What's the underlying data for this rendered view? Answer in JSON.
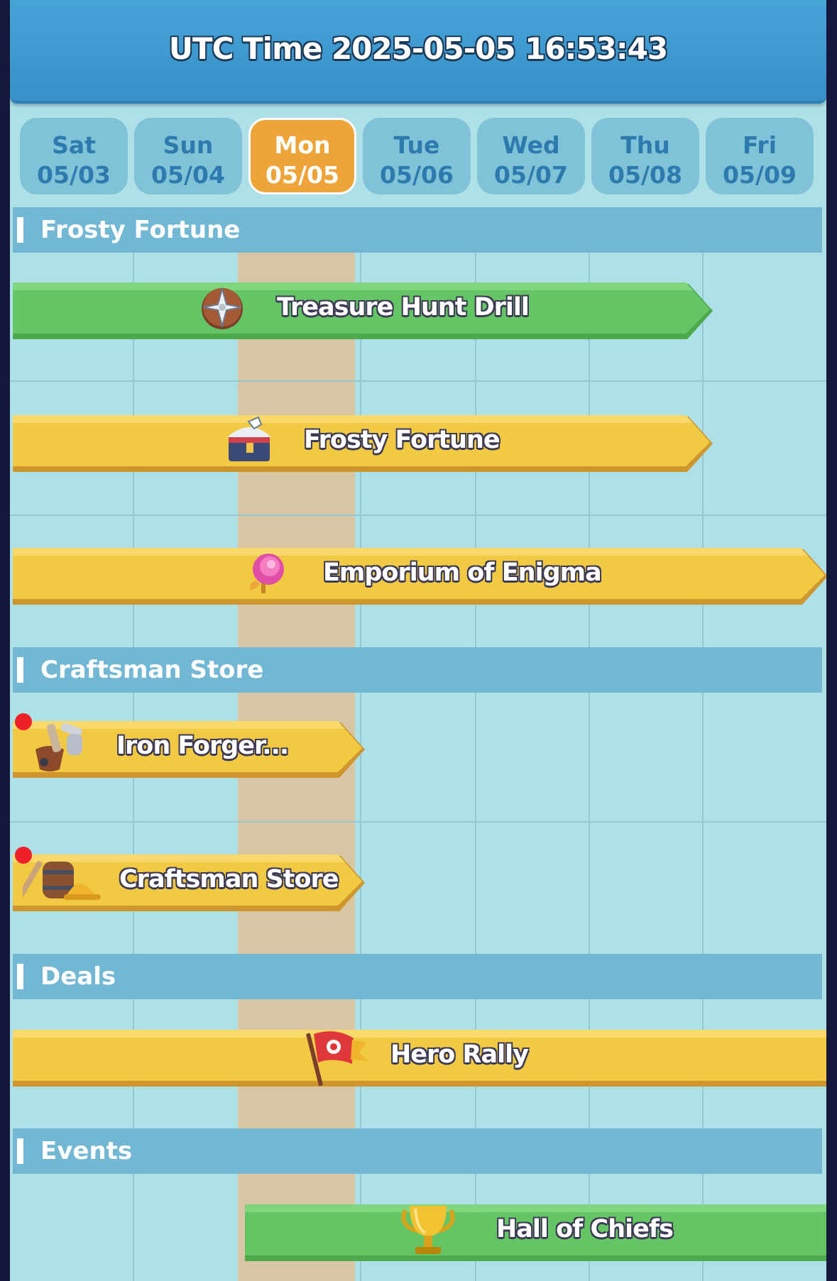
{
  "header": {
    "title": "UTC Time 2025-05-05 16:53:43"
  },
  "days": [
    {
      "name": "Sat",
      "date": "05/03",
      "active": false
    },
    {
      "name": "Sun",
      "date": "05/04",
      "active": false
    },
    {
      "name": "Mon",
      "date": "05/05",
      "active": true
    },
    {
      "name": "Tue",
      "date": "05/06",
      "active": false
    },
    {
      "name": "Wed",
      "date": "05/07",
      "active": false
    },
    {
      "name": "Thu",
      "date": "05/08",
      "active": false
    },
    {
      "name": "Fri",
      "date": "05/09",
      "active": false
    }
  ],
  "sections": [
    {
      "title": "Frosty Fortune"
    },
    {
      "title": "Craftsman Store"
    },
    {
      "title": "Deals"
    },
    {
      "title": "Events"
    }
  ],
  "events": [
    {
      "label": "Treasure Hunt Drill",
      "color": "green",
      "icon": "compass-shuriken-icon",
      "notification": false
    },
    {
      "label": "Frosty Fortune",
      "color": "yellow",
      "icon": "treasure-chest-icon",
      "notification": false
    },
    {
      "label": "Emporium of Enigma",
      "color": "yellow",
      "icon": "rose-icon",
      "notification": false
    },
    {
      "label": "Iron Forger...",
      "color": "yellow",
      "icon": "forge-tools-icon",
      "notification": true
    },
    {
      "label": "Craftsman Store",
      "color": "yellow",
      "icon": "barrel-helmet-icon",
      "notification": true
    },
    {
      "label": "Hero Rally",
      "color": "yellow",
      "icon": "rally-flag-icon",
      "notification": false
    },
    {
      "label": "Hall of Chiefs",
      "color": "green",
      "icon": "trophy-icon",
      "notification": false
    }
  ],
  "colors": {
    "header": "#3f9ad0",
    "background": "#ade1e7",
    "section": "#72b7d4",
    "active_day": "#efa43a",
    "green_banner": "#5fc15e",
    "yellow_banner": "#f1c943",
    "notification": "#f0202a"
  }
}
